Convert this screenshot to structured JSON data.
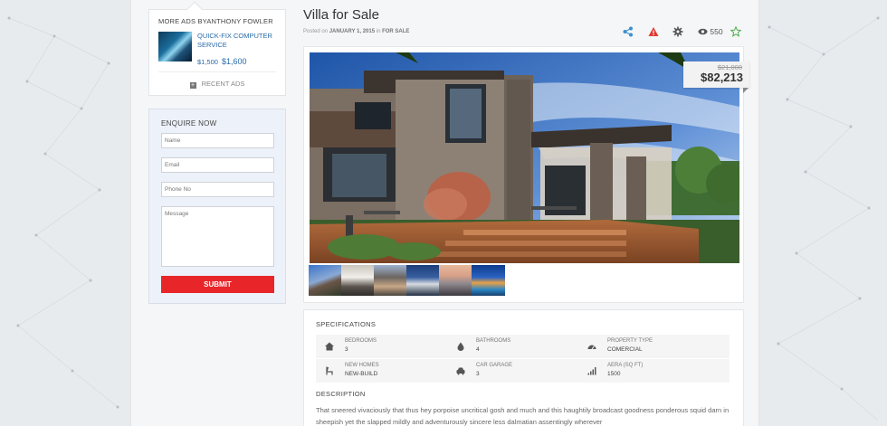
{
  "sidebar": {
    "more_ads": {
      "title": "MORE ADS BYANTHONY FOWLER",
      "item_name": "QUICK-FIX COMPUTER SERVICE",
      "item_price_old": "$1,500",
      "item_price": "$1,600",
      "recent_ads_label": "RECENT ADS"
    },
    "enquire": {
      "title": "ENQUIRE NOW",
      "name_placeholder": "Name",
      "email_placeholder": "Email",
      "phone_placeholder": "Phone No",
      "message_placeholder": "Message",
      "submit_label": "SUBMIT"
    }
  },
  "listing": {
    "title": "Villa for Sale",
    "posted_prefix": "Posted on",
    "posted_date": "JANUARY 1, 2015",
    "posted_in": "in",
    "category": "FOR SALE",
    "views": "550",
    "price_old": "$21,000",
    "price": "$82,213",
    "icons": [
      "share-icon",
      "report-icon",
      "gear-icon",
      "eye-icon",
      "star-icon"
    ]
  },
  "specifications": {
    "title": "SPECIFICATIONS",
    "rows": [
      [
        {
          "icon": "home-icon",
          "label": "BEDROOMS",
          "value": "3"
        },
        {
          "icon": "drop-icon",
          "label": "BATHROOMS",
          "value": "4"
        },
        {
          "icon": "dashboard-icon",
          "label": "PROPERTY TYPE",
          "value": "COMERCIAL"
        }
      ],
      [
        {
          "icon": "chair-icon",
          "label": "NEW HOMES",
          "value": "NEW-BUILD"
        },
        {
          "icon": "car-icon",
          "label": "CAR GARAGE",
          "value": "3"
        },
        {
          "icon": "signal-icon",
          "label": "AERA (SQ FT)",
          "value": "1500"
        }
      ]
    ]
  },
  "description": {
    "title": "DESCRIPTION",
    "text": "That sneered vivaciously that thus hey porpoise uncritical gosh and much and this haughtily broadcast goodness ponderous squid darn in sheepish yet the slapped mildly and adventurously sincere less dalmatian assentingly wherever"
  },
  "colors": {
    "accent_blue": "#2a6aa7",
    "submit_red": "#e8262a",
    "share_blue": "#3a8fd1",
    "warning_red": "#e03a2f",
    "star_green": "#4cae4c"
  }
}
